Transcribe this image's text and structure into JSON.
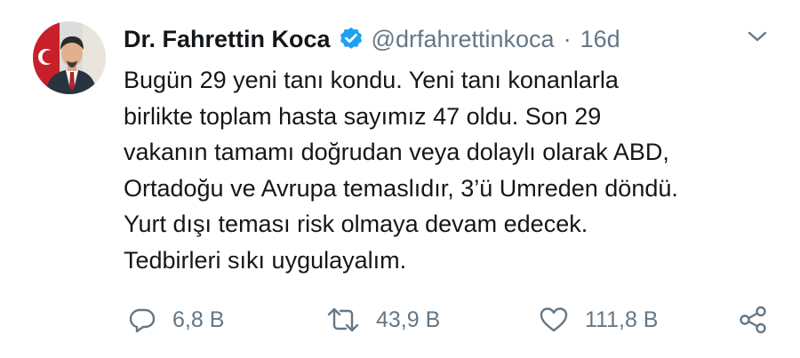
{
  "tweet": {
    "author_name": "Dr. Fahrettin Koca",
    "handle": "@drfahrettinkoca",
    "separator": "·",
    "time": "16d",
    "text": "Bugün 29 yeni tanı kondu. Yeni tanı konanlarla\nbirlikte toplam hasta sayımız 47 oldu. Son 29\nvakanın tamamı doğrudan veya dolaylı olarak ABD,\nOrtadoğu ve Avrupa temaslıdır, 3’ü Umreden döndü.\nYurt dışı teması risk olmaya devam edecek.\nTedbirleri sıkı uygulayalım."
  },
  "actions": {
    "replies": "6,8 B",
    "retweets": "43,9 B",
    "likes": "111,8 B"
  },
  "icons": {
    "avatar": "profile-photo",
    "verified": "verified-badge-icon",
    "menu": "chevron-down-icon",
    "reply": "reply-icon",
    "retweet": "retweet-icon",
    "like": "heart-icon",
    "share": "share-icon"
  },
  "colors": {
    "text": "#14171a",
    "secondary": "#657786",
    "verified": "#1da1f2"
  }
}
